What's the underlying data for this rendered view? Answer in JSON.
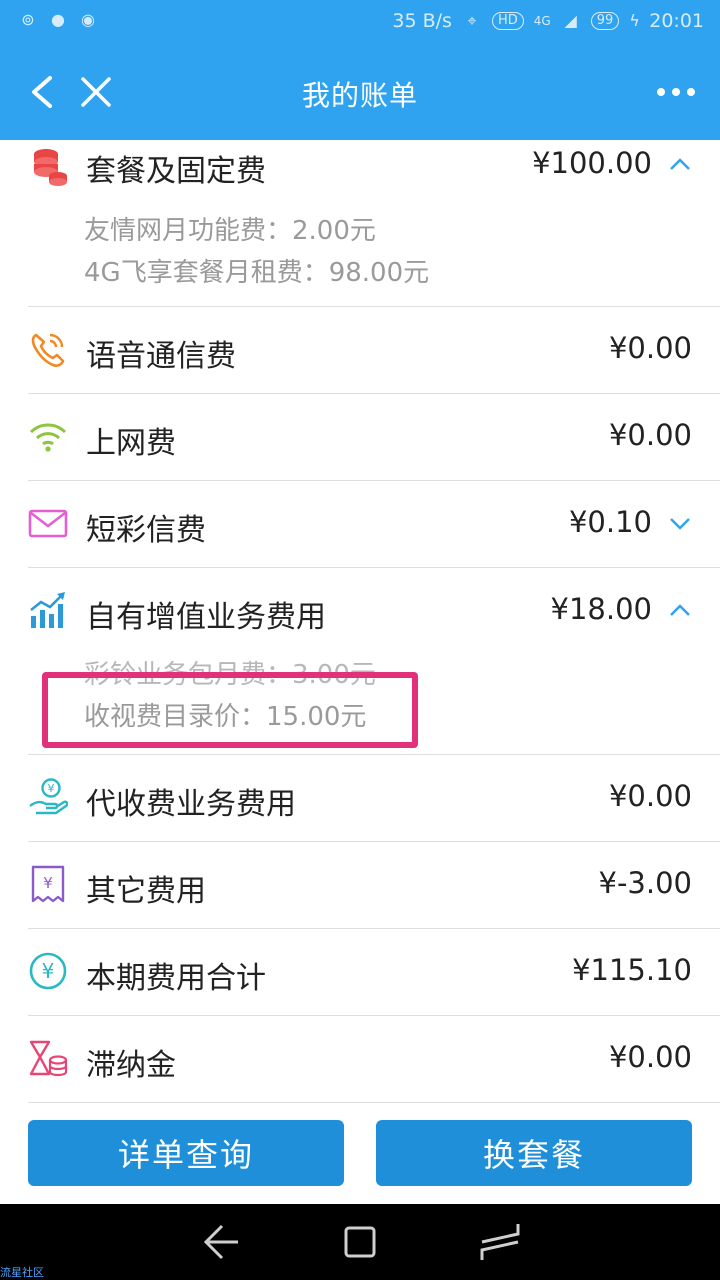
{
  "status": {
    "speed": "35 B/s",
    "hd": "HD",
    "network": "4G",
    "battery": "99",
    "time": "20:01"
  },
  "header": {
    "title": "我的账单"
  },
  "bill": {
    "package": {
      "label": "套餐及固定费",
      "amount": "¥100.00",
      "items": [
        "友情网月功能费：2.00元",
        "4G飞享套餐月租费：98.00元"
      ]
    },
    "voice": {
      "label": "语音通信费",
      "amount": "¥0.00"
    },
    "internet": {
      "label": "上网费",
      "amount": "¥0.00"
    },
    "sms": {
      "label": "短彩信费",
      "amount": "¥0.10"
    },
    "vas": {
      "label": "自有增值业务费用",
      "amount": "¥18.00",
      "items": [
        "彩铃业务包月费：3.00元",
        "收视费目录价：15.00元"
      ]
    },
    "agency": {
      "label": "代收费业务费用",
      "amount": "¥0.00"
    },
    "other": {
      "label": "其它费用",
      "amount": "¥-3.00"
    },
    "total": {
      "label": "本期费用合计",
      "amount": "¥115.10"
    },
    "late": {
      "label": "滞纳金",
      "amount": "¥0.00"
    }
  },
  "actions": {
    "detail_query": "详单查询",
    "change_plan": "换套餐"
  },
  "watermark": "流星社区",
  "colors": {
    "header_bg": "#2fa3f0",
    "button_bg": "#1e8fd8",
    "highlight": "#e0317a"
  }
}
